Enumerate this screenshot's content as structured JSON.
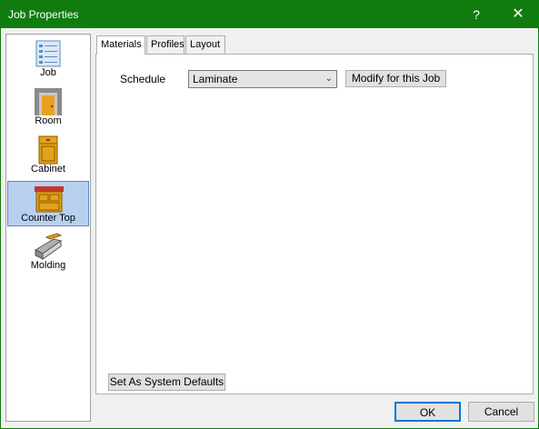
{
  "window": {
    "title": "Job Properties",
    "help_glyph": "?",
    "close_glyph": "✕"
  },
  "sidebar": {
    "items": [
      {
        "label": "Job",
        "icon": "job-icon"
      },
      {
        "label": "Room",
        "icon": "room-icon"
      },
      {
        "label": "Cabinet",
        "icon": "cabinet-icon"
      },
      {
        "label": "Counter Top",
        "icon": "counter-top-icon",
        "selected": true
      },
      {
        "label": "Molding",
        "icon": "molding-icon"
      }
    ]
  },
  "tabs": [
    {
      "label": "Materials",
      "active": true
    },
    {
      "label": "Profiles"
    },
    {
      "label": "Layout"
    }
  ],
  "materials": {
    "schedule_label": "Schedule",
    "schedule_value": "Laminate",
    "modify_button": "Modify for this Job"
  },
  "footer": {
    "defaults_button": "Set As System Defaults",
    "ok_button": "OK",
    "cancel_button": "Cancel"
  },
  "colors": {
    "titlebar": "#107c10",
    "selection": "#b8d0f0",
    "focus": "#0078d7"
  }
}
